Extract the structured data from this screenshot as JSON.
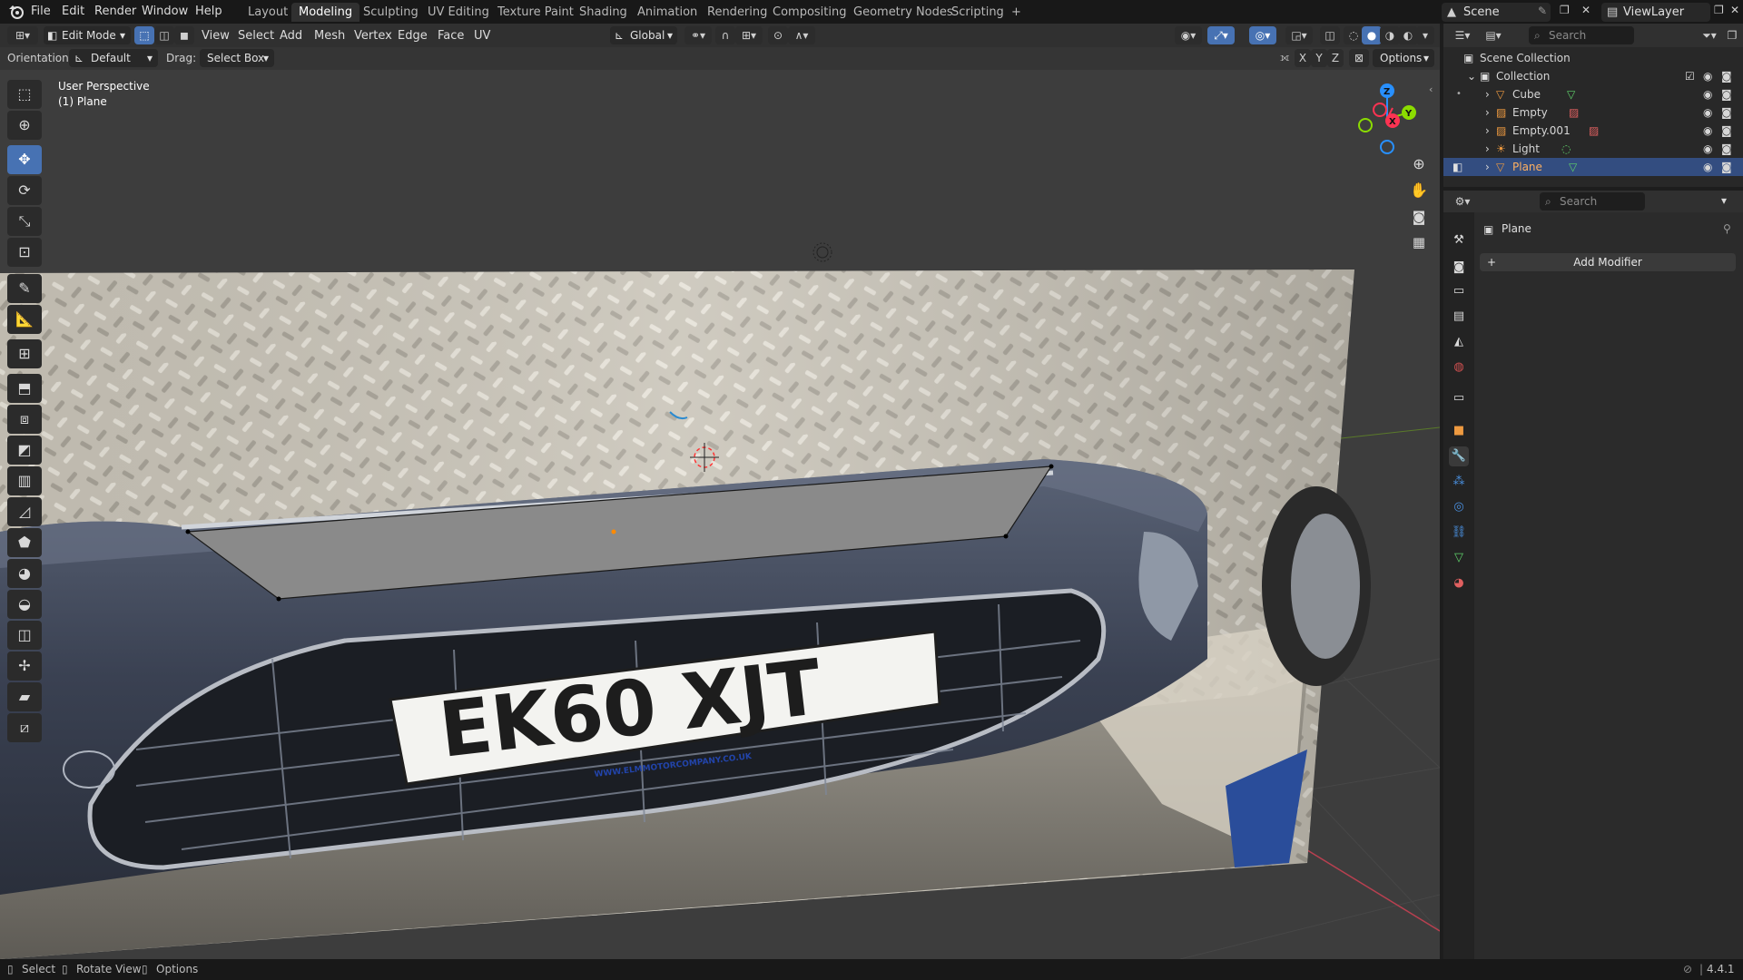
{
  "topbar": {
    "menus": [
      "File",
      "Edit",
      "Render",
      "Window",
      "Help"
    ],
    "workspaces": [
      "Layout",
      "Modeling",
      "Sculpting",
      "UV Editing",
      "Texture Paint",
      "Shading",
      "Animation",
      "Rendering",
      "Compositing",
      "Geometry Nodes",
      "Scripting"
    ],
    "active_workspace": "Modeling",
    "add_tab": "+",
    "scene": "Scene",
    "view_layer": "ViewLayer"
  },
  "viewport_header": {
    "mode": "Edit Mode",
    "menus": [
      "View",
      "Select",
      "Add",
      "Mesh",
      "Vertex",
      "Edge",
      "Face",
      "UV"
    ],
    "transform_orientation": "Global",
    "options_label": "Options",
    "axis_x": "X",
    "axis_y": "Y",
    "axis_z": "Z"
  },
  "tool_header": {
    "orientation_label": "Orientation:",
    "orientation_value": "Default",
    "drag_label": "Drag:",
    "drag_value": "Select Box"
  },
  "viewport_info": {
    "perspective": "User Perspective",
    "object": "(1) Plane"
  },
  "plate_text": "EK60 XJT",
  "plate_subtext": "WWW.ELMMOTORCOMPANY.CO.UK",
  "gizmo": {
    "x": "X",
    "y": "Y",
    "z": "Z"
  },
  "outliner": {
    "search_placeholder": "Search",
    "scene_collection": "Scene Collection",
    "collection": "Collection",
    "items": [
      {
        "name": "Cube",
        "selected": false
      },
      {
        "name": "Empty",
        "selected": false
      },
      {
        "name": "Empty.001",
        "selected": false
      },
      {
        "name": "Light",
        "selected": false
      },
      {
        "name": "Plane",
        "selected": true
      }
    ]
  },
  "properties": {
    "search_placeholder": "Search",
    "object_name": "Plane",
    "add_modifier": "Add Modifier"
  },
  "statusbar": {
    "select": "Select",
    "rotate_view": "Rotate View",
    "options": "Options",
    "version": "4.4.1"
  },
  "colors": {
    "accent": "#4772b3",
    "selected_row": "#334d80",
    "mesh_fill": "#8a8a8a",
    "axis_x": "#ff3352",
    "axis_y": "#8bdc00",
    "axis_z": "#2890ff"
  }
}
